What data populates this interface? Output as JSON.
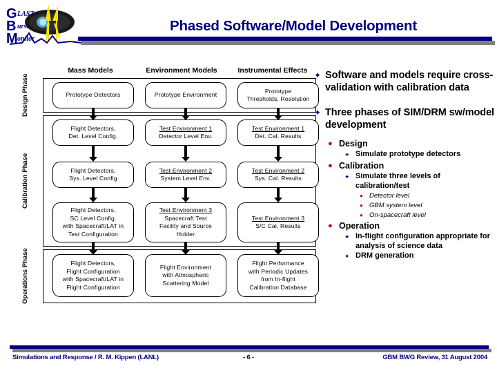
{
  "header": {
    "title": "Phased Software/Model Development",
    "logo_name": "gbm-glast-burst-monitor-logo",
    "logo_letters": [
      "G",
      "B",
      "M"
    ],
    "logo_words": [
      "LAST",
      "urst",
      "onitor"
    ]
  },
  "diagram": {
    "column_headers": [
      "Mass Models",
      "Environment Models",
      "Instrumental Effects"
    ],
    "phases": [
      {
        "label": "Design\nPhase",
        "label_lines": [
          "Design",
          "Phase"
        ],
        "rows": [
          {
            "cells": [
              {
                "heading": "",
                "lines": [
                  "Prototype Detectors"
                ]
              },
              {
                "heading": "",
                "lines": [
                  "Prototype Environment"
                ]
              },
              {
                "heading": "",
                "lines": [
                  "Prototype",
                  "Thresholds, Resolution"
                ]
              }
            ]
          }
        ]
      },
      {
        "label": "Calibration\nPhase",
        "label_lines": [
          "Calibration",
          "Phase"
        ],
        "rows": [
          {
            "cells": [
              {
                "heading": "",
                "lines": [
                  "Flight Detectors,",
                  "Det. Level Config."
                ]
              },
              {
                "heading": "Test Environment 1",
                "lines": [
                  "Detector Level Env."
                ]
              },
              {
                "heading": "Test Environment 1",
                "lines": [
                  "Det. Cal. Results"
                ]
              }
            ]
          },
          {
            "cells": [
              {
                "heading": "",
                "lines": [
                  "Flight Detectors,",
                  "Sys. Level Config"
                ]
              },
              {
                "heading": "Test Environment 2",
                "lines": [
                  "System Level Env."
                ]
              },
              {
                "heading": "Test Environment 2",
                "lines": [
                  "Sys. Cal. Results"
                ]
              }
            ]
          },
          {
            "cells": [
              {
                "heading": "",
                "lines": [
                  "Flight Detectors,",
                  "SC Level Config.",
                  "with Spacecraft/LAT in",
                  "Test Configuration"
                ]
              },
              {
                "heading": "Test Environment 3",
                "lines": [
                  "Spacecraft Test",
                  "Facility and Source",
                  "Holder"
                ]
              },
              {
                "heading": "Test Environment 3",
                "lines": [
                  "S/C Cal. Results"
                ]
              }
            ]
          }
        ]
      },
      {
        "label": "Operations\nPhase",
        "label_lines": [
          "Operations",
          "Phase"
        ],
        "rows": [
          {
            "cells": [
              {
                "heading": "",
                "lines": [
                  "Flight Detectors,",
                  "Flight Configuration",
                  "with Spacecraft/LAT in",
                  "Flight Configuration"
                ]
              },
              {
                "heading": "",
                "lines": [
                  "Flight Environment",
                  "with Atmospheric",
                  "Scattering Model"
                ]
              },
              {
                "heading": "",
                "lines": [
                  "Flight Performance",
                  "with Periodic Updates",
                  "from In-flight",
                  "Calibration Database"
                ]
              }
            ]
          }
        ]
      }
    ]
  },
  "bullets": [
    {
      "level": 1,
      "marker": "star-navy",
      "text": "Software and models require cross-validation with calibration data"
    },
    {
      "level": 1,
      "marker": "star-navy",
      "text": "Three phases of SIM/DRM sw/model development"
    },
    {
      "level": 2,
      "marker": "dot-red",
      "text": "Design"
    },
    {
      "level": 3,
      "marker": "star-navy",
      "text": "Simulate prototype detectors"
    },
    {
      "level": 2,
      "marker": "dot-red",
      "text": "Calibration"
    },
    {
      "level": 3,
      "marker": "star-navy",
      "text": "Simulate three levels of calibration/test"
    },
    {
      "level": 4,
      "marker": "dot-red",
      "text": "Detector level"
    },
    {
      "level": 4,
      "marker": "dot-red",
      "text": "GBM system level"
    },
    {
      "level": 4,
      "marker": "dot-red",
      "text": "On-spacecraft level"
    },
    {
      "level": 2,
      "marker": "dot-red",
      "text": "Operation"
    },
    {
      "level": 3,
      "marker": "star-navy",
      "text": "In-flight configuration appropriate for analysis of science data"
    },
    {
      "level": 3,
      "marker": "star-navy",
      "text": "DRM generation"
    }
  ],
  "markers": {
    "star-navy": "✦",
    "dot-red": "●"
  },
  "footer": {
    "left": "Simulations and Response / R. M. Kippen (LANL)",
    "center": "- 6 -",
    "right": "GBM BWG Review, 31 August 2004"
  },
  "colors": {
    "navy": "#000080",
    "grey_shadow": "#808080",
    "red_bullet": "#cc0000",
    "black": "#000000",
    "logo_yellow": "#ffe000",
    "logo_cyan": "#4ea8d8"
  }
}
